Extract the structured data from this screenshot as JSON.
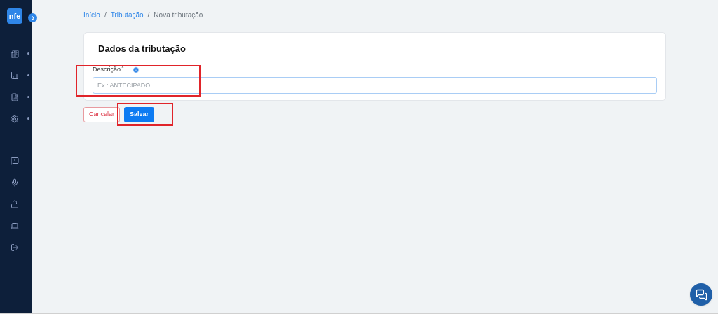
{
  "logo": {
    "text": "nfe"
  },
  "sidebar": {
    "items": [
      {
        "kind": "newspaper",
        "expandable": true
      },
      {
        "kind": "chart",
        "expandable": true
      },
      {
        "kind": "report",
        "expandable": true
      },
      {
        "kind": "settings",
        "expandable": true
      },
      {
        "kind": "help",
        "expandable": false
      },
      {
        "kind": "mic",
        "expandable": false
      },
      {
        "kind": "lock",
        "expandable": false
      },
      {
        "kind": "laptop",
        "expandable": false
      },
      {
        "kind": "logout",
        "expandable": false
      }
    ]
  },
  "breadcrumb": [
    {
      "label": "Início",
      "current": false
    },
    {
      "separator": "/",
      "label": "Tributação",
      "current": false
    },
    {
      "separator": "/",
      "label": "Nova tributação",
      "current": true
    }
  ],
  "card": {
    "title": "Dados da tributação",
    "field": {
      "label": "Descrição",
      "required_mark": "*",
      "placeholder": "Ex.: ANTECIPADO"
    }
  },
  "buttons": [
    {
      "label": "Cancelar",
      "kind": "cancel"
    },
    {
      "label": "Salvar",
      "kind": "primary"
    }
  ]
}
